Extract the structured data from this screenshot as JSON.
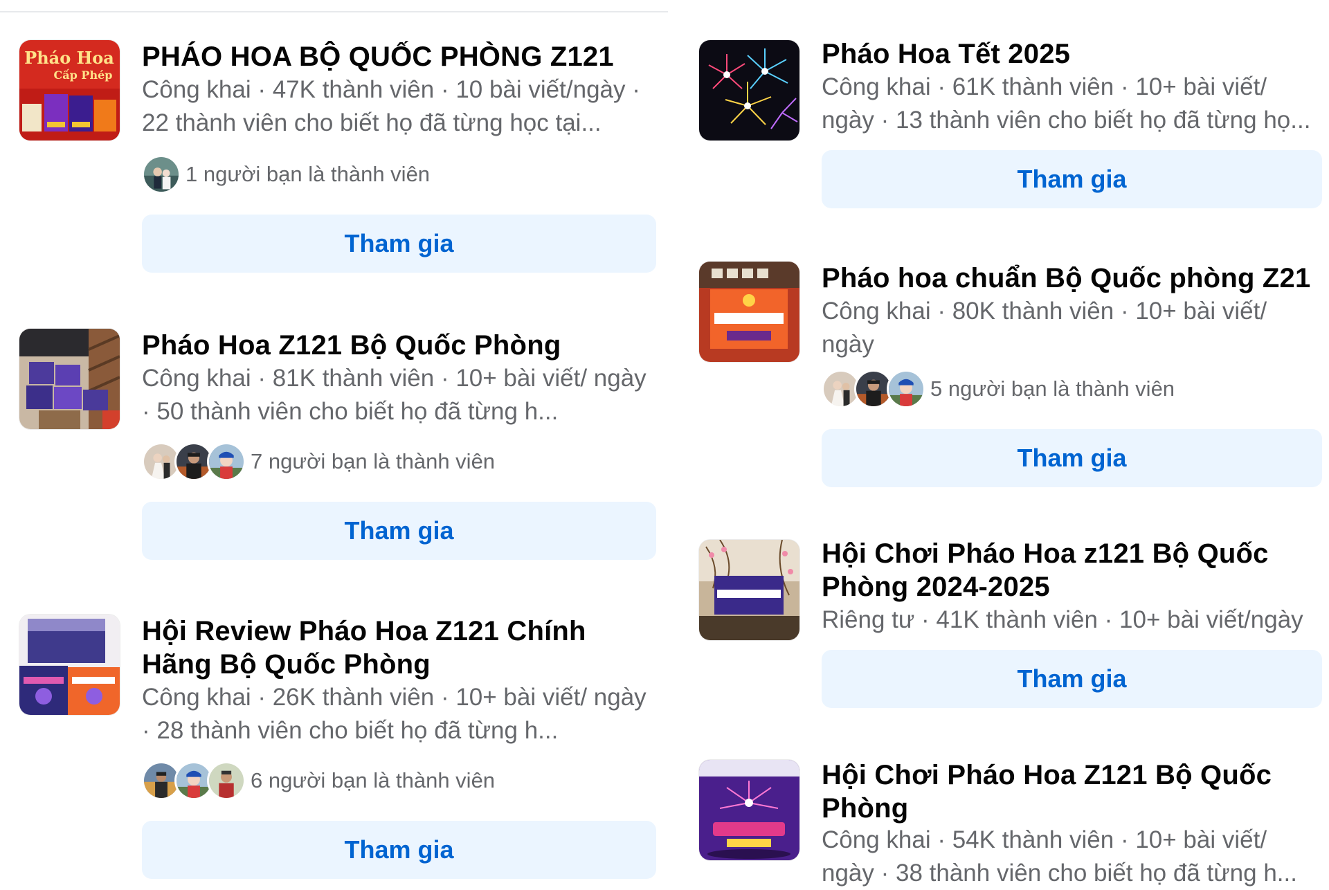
{
  "join_label": "Tham gia",
  "colors": {
    "title": "#050505",
    "meta": "#65676b",
    "button_bg": "#ebf5ff",
    "button_text": "#0064d1"
  },
  "groups": [
    {
      "title": "PHÁO HOA BỘ QUỐC PHÒNG Z121",
      "meta": "Công khai · 47K thành viên · 10 bài viết/ngày · 22 thành viên cho biết họ đã từng học tại...",
      "friends": "1 người bạn là thành viên",
      "thumb_text": [
        "Pháo Hoa",
        "Cấp Phép"
      ]
    },
    {
      "title": "Pháo Hoa Z121 Bộ Quốc Phòng",
      "meta": "Công khai · 81K thành viên · 10+ bài viết/ ngày · 50 thành viên cho biết họ đã từng h...",
      "friends": "7 người bạn là thành viên"
    },
    {
      "title": "Hội Review Pháo Hoa Z121 Chính Hãng Bộ Quốc Phòng",
      "meta": "Công khai · 26K thành viên · 10+ bài viết/ ngày · 28 thành viên cho biết họ đã từng h...",
      "friends": "6 người bạn là thành viên"
    },
    {
      "title": "Pháo Hoa Tết 2025",
      "meta": "Công khai · 61K thành viên · 10+ bài viết/ ngày · 13 thành viên cho biết họ đã từng họ..."
    },
    {
      "title": "Pháo hoa chuẩn Bộ Quốc phòng Z21",
      "meta": "Công khai · 80K thành viên · 10+ bài viết/ ngày",
      "friends": "5 người bạn là thành viên"
    },
    {
      "title": "Hội Chơi Pháo Hoa z121 Bộ Quốc Phòng 2024-2025",
      "meta": "Riêng tư · 41K thành viên · 10+ bài viết/ngày"
    },
    {
      "title": "Hội Chơi Pháo Hoa Z121 Bộ Quốc Phòng",
      "meta": "Công khai · 54K thành viên · 10+ bài viết/ ngày · 38 thành viên cho biết họ đã từng h..."
    }
  ]
}
